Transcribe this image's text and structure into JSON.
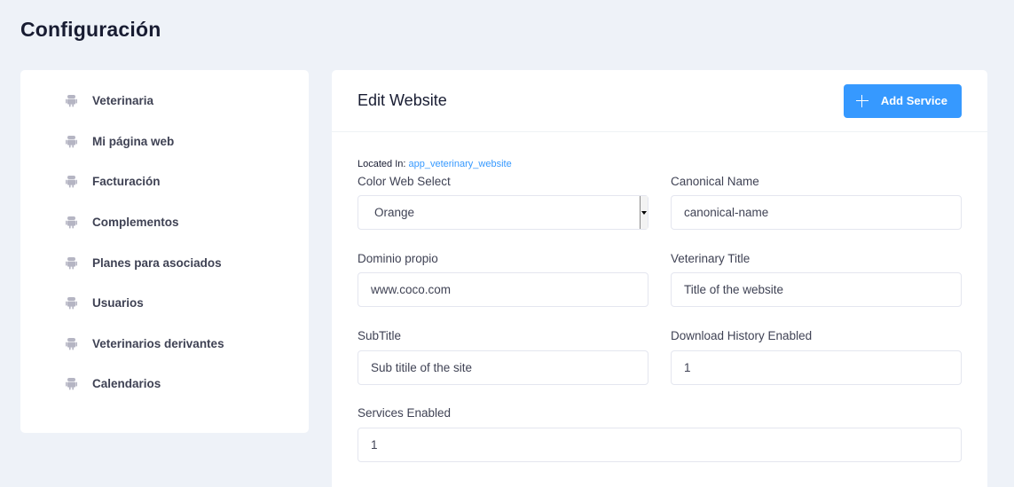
{
  "page": {
    "title": "Configuración"
  },
  "sidebar": {
    "items": [
      {
        "label": "Veterinaria"
      },
      {
        "label": "Mi página web"
      },
      {
        "label": "Facturación"
      },
      {
        "label": "Complementos"
      },
      {
        "label": "Planes para asociados"
      },
      {
        "label": "Usuarios"
      },
      {
        "label": "Veterinarios derivantes"
      },
      {
        "label": "Calendarios"
      }
    ],
    "icon": "android-icon",
    "icon_color": "#b5b5c3"
  },
  "main": {
    "title": "Edit Website",
    "add_button_label": "Add Service",
    "located_prefix": "Located In:",
    "located_path": "app_veterinary_website",
    "fields": {
      "color_web_select": {
        "label": "Color Web Select",
        "value": "Orange"
      },
      "canonical_name": {
        "label": "Canonical Name",
        "value": "canonical-name"
      },
      "dominio_propio": {
        "label": "Dominio propio",
        "value": "www.coco.com"
      },
      "veterinary_title": {
        "label": "Veterinary Title",
        "value": "Title of the website"
      },
      "subtitle": {
        "label": "SubTitle",
        "value": "Sub titile of the site"
      },
      "download_history_enabled": {
        "label": "Download History Enabled",
        "value": "1"
      },
      "services_enabled": {
        "label": "Services Enabled",
        "value": "1"
      }
    }
  },
  "colors": {
    "accent": "#3699ff",
    "background": "#eef2f8",
    "card": "#ffffff"
  }
}
